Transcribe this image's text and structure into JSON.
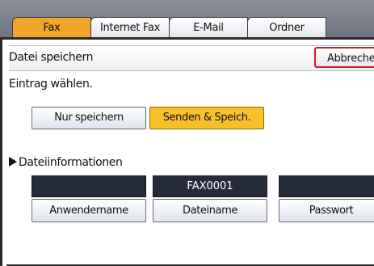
{
  "tabs": [
    {
      "label": "Fax",
      "active": true
    },
    {
      "label": "Internet Fax",
      "active": false
    },
    {
      "label": "E-Mail",
      "active": false
    },
    {
      "label": "Ordner",
      "active": false
    }
  ],
  "header": {
    "title": "Datei speichern",
    "cancel_label": "Abbrechen"
  },
  "instruction": "Eintrag wählen.",
  "options": {
    "store_only": "Nur speichern",
    "send_and_store": "Senden & Speich."
  },
  "file_info": {
    "section_title": "Dateiinformationen",
    "fields": [
      {
        "value": "",
        "label": "Anwendername"
      },
      {
        "value": "FAX0001",
        "label": "Dateiname"
      },
      {
        "value": "",
        "label": "Passwort"
      }
    ]
  },
  "colors": {
    "active_tab": "#f0a52b",
    "selected_option": "#f6c12a",
    "cancel_border": "#c8202a",
    "field_value_bg": "#262b3a"
  }
}
